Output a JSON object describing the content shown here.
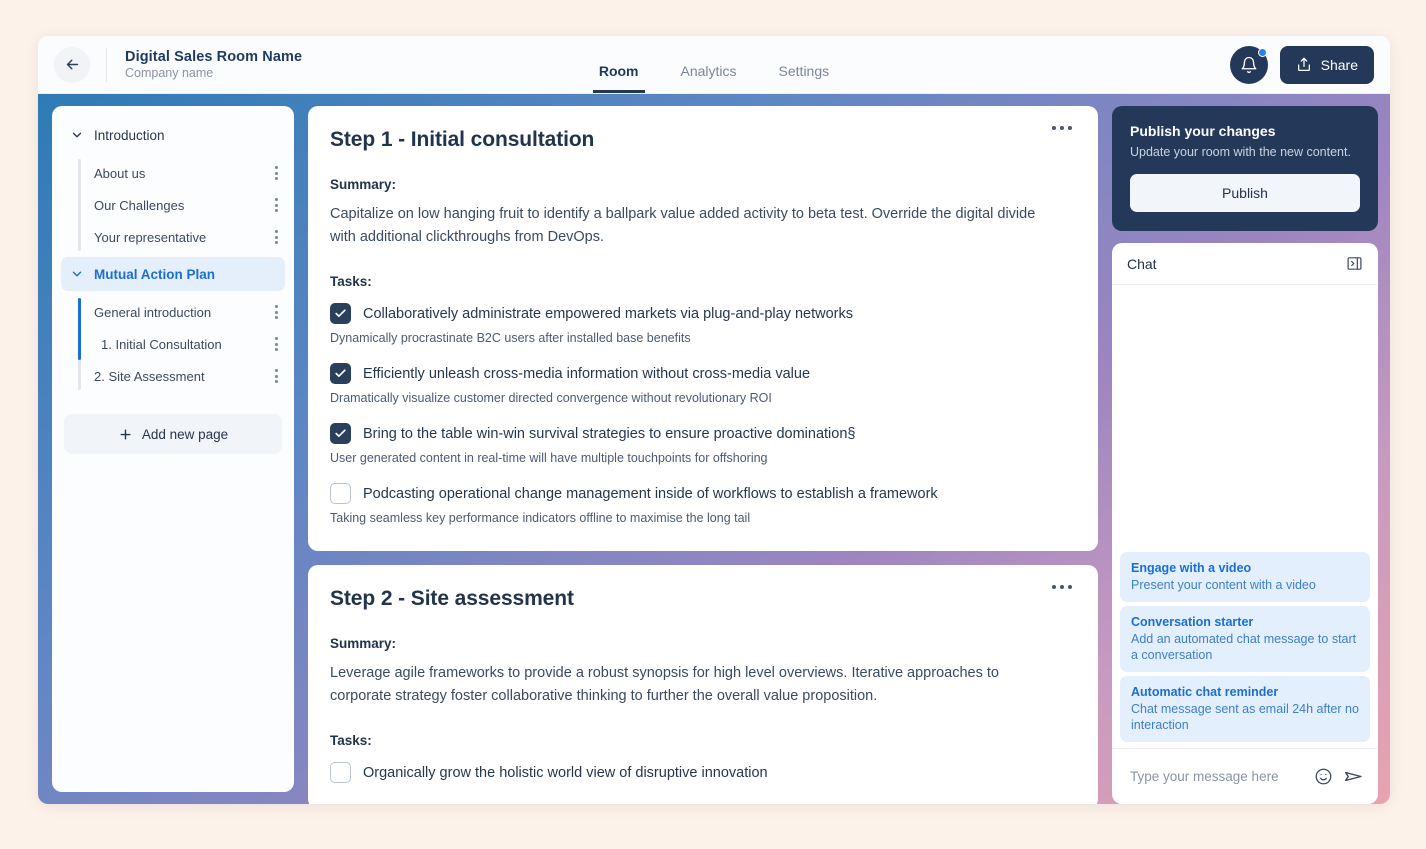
{
  "header": {
    "back_icon": "arrow-left-icon",
    "room_title": "Digital Sales Room Name",
    "company_name": "Company name",
    "tabs": [
      {
        "label": "Room",
        "active": true
      },
      {
        "label": "Analytics",
        "active": false
      },
      {
        "label": "Settings",
        "active": false
      }
    ],
    "notifications_icon": "bell-icon",
    "has_notification_dot": true,
    "share_label": "Share",
    "share_icon": "share-icon"
  },
  "sidebar": {
    "sections": [
      {
        "label": "Introduction",
        "active": false,
        "pages": [
          {
            "label": "About us"
          },
          {
            "label": "Our Challenges"
          },
          {
            "label": "Your representative"
          }
        ]
      },
      {
        "label": "Mutual Action Plan",
        "active": true,
        "pages": [
          {
            "label": "General introduction"
          },
          {
            "label": "1. Initial Consultation"
          },
          {
            "label": "2. Site Assessment"
          }
        ]
      }
    ],
    "add_page_label": "Add new page",
    "add_page_icon": "plus-icon"
  },
  "main": {
    "cards": [
      {
        "title": "Step 1 - Initial consultation",
        "summary_label": "Summary:",
        "summary": "Capitalize on low hanging fruit to identify a ballpark value added activity to beta test. Override the digital divide with additional clickthroughs from DevOps.",
        "tasks_label": "Tasks:",
        "tasks": [
          {
            "checked": true,
            "title": "Collaboratively administrate empowered markets via plug-and-play networks",
            "sub": "Dynamically procrastinate B2C users after installed base benefits"
          },
          {
            "checked": true,
            "title": "Efficiently unleash cross-media information without cross-media value",
            "sub": "Dramatically visualize customer directed convergence without revolutionary ROI"
          },
          {
            "checked": true,
            "title": "Bring to the table win-win survival strategies to ensure proactive domination§",
            "sub": "User generated content in real-time will have multiple touchpoints for offshoring"
          },
          {
            "checked": false,
            "title": "Podcasting operational change management inside of workflows to establish a framework",
            "sub": "Taking seamless key performance indicators offline to maximise the long tail"
          }
        ]
      },
      {
        "title": "Step 2 - Site assessment",
        "summary_label": "Summary:",
        "summary": "Leverage agile frameworks to provide a robust synopsis for high level overviews. Iterative approaches to corporate strategy foster collaborative thinking to further the overall value proposition.",
        "tasks_label": "Tasks:",
        "tasks": [
          {
            "checked": false,
            "title": "Organically grow the holistic world view of disruptive innovation",
            "sub": ""
          }
        ]
      }
    ]
  },
  "publish": {
    "title": "Publish your changes",
    "subtitle": "Update your room with the new content.",
    "button_label": "Publish"
  },
  "chat": {
    "title": "Chat",
    "collapse_icon": "collapse-panel-icon",
    "suggestions": [
      {
        "title": "Engage with a video",
        "sub": "Present your content with a video"
      },
      {
        "title": "Conversation starter",
        "sub": "Add an automated chat message to start a conversation"
      },
      {
        "title": "Automatic chat reminder",
        "sub": "Chat message sent as email 24h after no interaction"
      }
    ],
    "input_placeholder": "Type your message here",
    "emoji_icon": "smiley-icon",
    "send_icon": "send-icon"
  },
  "colors": {
    "page_background": "#FDF2E9",
    "accent_blue": "#1B6FD4",
    "dark_navy": "#24395A",
    "suggestion_bg": "#E3EFFC"
  }
}
